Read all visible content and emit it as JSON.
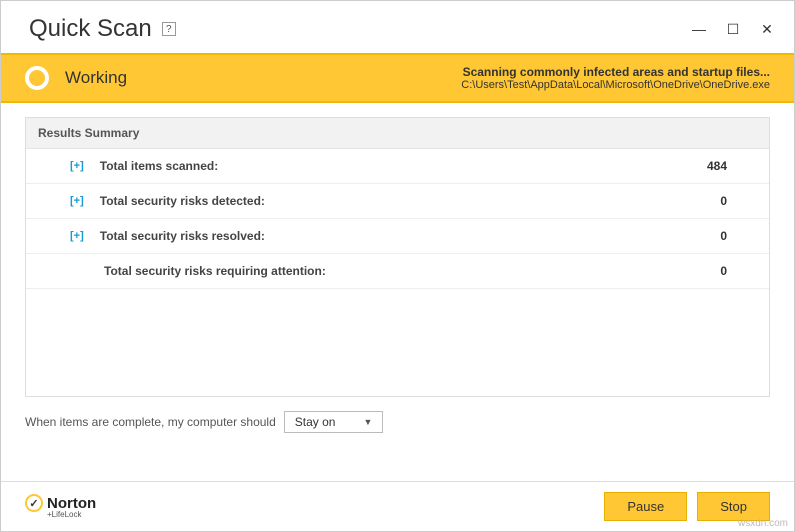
{
  "window": {
    "title": "Quick Scan",
    "help": "?"
  },
  "status": {
    "label": "Working",
    "message": "Scanning commonly infected areas and startup files...",
    "path": "C:\\Users\\Test\\AppData\\Local\\Microsoft\\OneDrive\\OneDrive.exe"
  },
  "results": {
    "header": "Results Summary",
    "rows": [
      {
        "expand": "[+]",
        "label": "Total items scanned:",
        "value": "484"
      },
      {
        "expand": "[+]",
        "label": "Total security risks detected:",
        "value": "0"
      },
      {
        "expand": "[+]",
        "label": "Total security risks resolved:",
        "value": "0"
      },
      {
        "expand": "",
        "label": "Total security risks requiring attention:",
        "value": "0"
      }
    ]
  },
  "footer": {
    "prompt": "When items are complete, my computer should",
    "dropdown": {
      "selected": "Stay on"
    }
  },
  "brand": {
    "name": "Norton",
    "sub": "+LifeLock"
  },
  "buttons": {
    "pause": "Pause",
    "stop": "Stop"
  },
  "watermark": "wsxdn.com"
}
